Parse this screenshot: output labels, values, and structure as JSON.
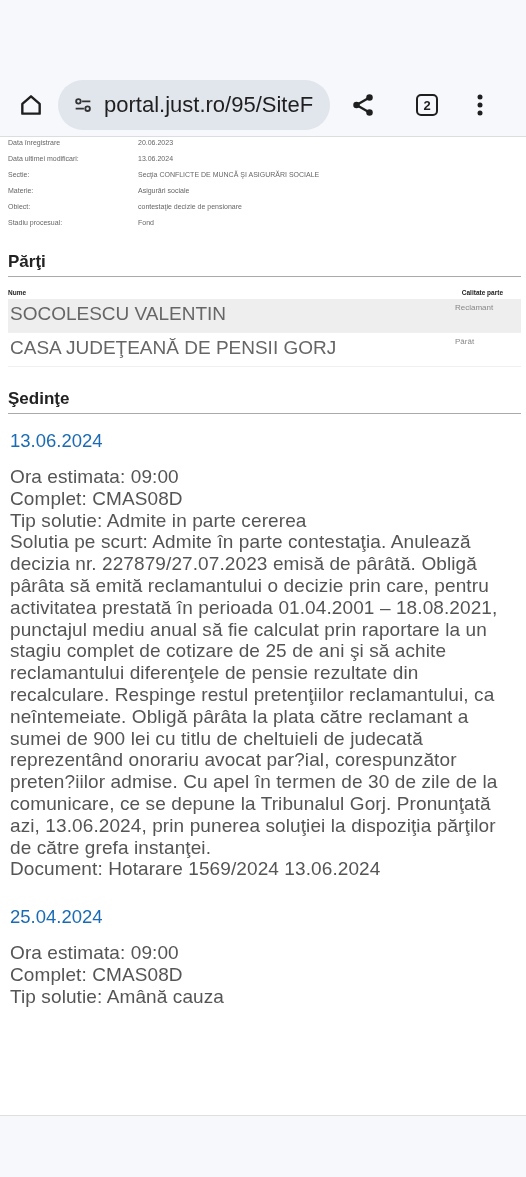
{
  "toolbar": {
    "url": "portal.just.ro/95/SiteF",
    "tab_count": "2"
  },
  "details": [
    {
      "label": "Data înregistrare",
      "value": "20.06.2023"
    },
    {
      "label": "Data ultimei modificari:",
      "value": "13.06.2024"
    },
    {
      "label": "Sectie:",
      "value": "Secţia CONFLICTE DE MUNCĂ ŞI ASIGURĂRI SOCIALE"
    },
    {
      "label": "Materie:",
      "value": "Asigurări sociale"
    },
    {
      "label": "Obiect:",
      "value": "contestaţie decizie de pensionare"
    },
    {
      "label": "Stadiu procesual:",
      "value": "Fond"
    }
  ],
  "parties": {
    "title": "Părţi",
    "columns": [
      "Nume",
      "Calitate parte"
    ],
    "rows": [
      {
        "name": "SOCOLESCU VALENTIN",
        "role": "Reclamant",
        "selected": true
      },
      {
        "name": "CASA JUDEŢEANĂ DE PENSII GORJ",
        "role": "Pârât",
        "selected": false
      }
    ]
  },
  "hearings": {
    "title": "Şedinţe",
    "items": [
      {
        "date": "13.06.2024",
        "lines": [
          "Ora estimata: 09:00",
          "Complet: CMAS08D",
          "Tip solutie: Admite in parte cererea",
          "Solutia pe scurt: Admite în parte contestaţia. Anulează decizia nr. 227879/27.07.2023 emisă de pârâtă. Obligă pârâta să emită reclamantului o decizie prin care, pentru activitatea prestată în perioada 01.04.2001 – 18.08.2021, punctajul mediu anual să fie calculat prin raportare la un stagiu complet de cotizare de 25 de ani şi să achite reclamantului diferenţele de pensie rezultate din recalculare. Respinge restul pretenţiilor reclamantului, ca neîntemeiate. Obligă pârâta la plata către reclamant a sumei de 900 lei cu titlu de cheltuieli de judecată reprezentând onorariu avocat par?ial, corespunzător preten?iilor admise. Cu apel în termen de 30 de zile de la comunicare, ce se depune la Tribunalul Gorj. Pronunţată azi, 13.06.2024, prin punerea soluţiei la dispoziţia părţilor de către grefa instanţei.",
          "Document: Hotarare  1569/2024  13.06.2024"
        ]
      },
      {
        "date": "25.04.2024",
        "lines": [
          "Ora estimata: 09:00",
          "Complet: CMAS08D",
          "Tip solutie: Amână cauza"
        ]
      }
    ]
  }
}
